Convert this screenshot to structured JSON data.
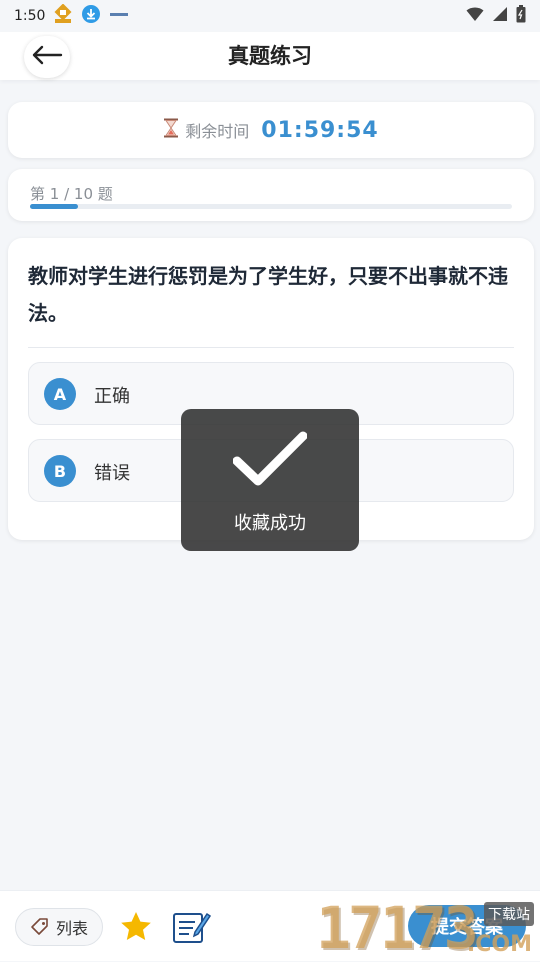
{
  "status_bar": {
    "time": "1:50",
    "icons": [
      "app-notification-icon",
      "download-icon",
      "small-app-icon",
      "wifi-icon",
      "signal-icon",
      "battery-icon"
    ]
  },
  "header": {
    "title": "真题练习",
    "back_icon": "arrow-left-icon"
  },
  "timer": {
    "label": "剩余时间",
    "value": "01:59:54",
    "icon": "hourglass-icon"
  },
  "progress": {
    "text": "第 1 / 10 题",
    "fraction": 0.1
  },
  "question": {
    "text": "教师对学生进行惩罚是为了学生好，只要不出事就不违法。",
    "options": [
      {
        "letter": "A",
        "text": "正确"
      },
      {
        "letter": "B",
        "text": "错误"
      }
    ]
  },
  "toast": {
    "text": "收藏成功",
    "icon": "checkmark-icon"
  },
  "bottom_bar": {
    "list_label": "列表",
    "submit_label": "提交答案"
  },
  "watermark": {
    "number": "17173",
    "tag": "下载站",
    "com": ".COM"
  },
  "colors": {
    "accent": "#3a8fd0",
    "star": "#f5b800",
    "toast_bg": "#303030"
  }
}
